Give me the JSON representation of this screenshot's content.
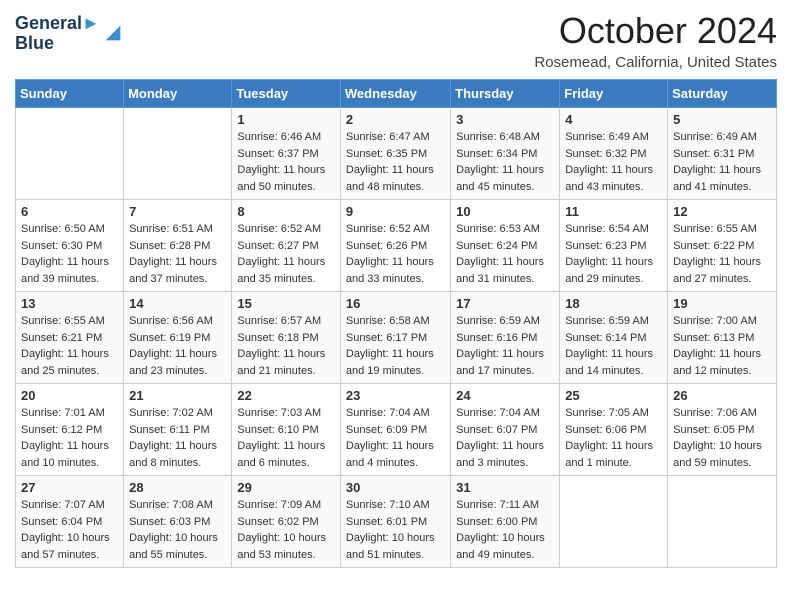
{
  "logo": {
    "line1": "General",
    "line2": "Blue"
  },
  "title": "October 2024",
  "location": "Rosemead, California, United States",
  "days_header": [
    "Sunday",
    "Monday",
    "Tuesday",
    "Wednesday",
    "Thursday",
    "Friday",
    "Saturday"
  ],
  "weeks": [
    [
      {
        "day": "",
        "sunrise": "",
        "sunset": "",
        "daylight": ""
      },
      {
        "day": "",
        "sunrise": "",
        "sunset": "",
        "daylight": ""
      },
      {
        "day": "1",
        "sunrise": "Sunrise: 6:46 AM",
        "sunset": "Sunset: 6:37 PM",
        "daylight": "Daylight: 11 hours and 50 minutes."
      },
      {
        "day": "2",
        "sunrise": "Sunrise: 6:47 AM",
        "sunset": "Sunset: 6:35 PM",
        "daylight": "Daylight: 11 hours and 48 minutes."
      },
      {
        "day": "3",
        "sunrise": "Sunrise: 6:48 AM",
        "sunset": "Sunset: 6:34 PM",
        "daylight": "Daylight: 11 hours and 45 minutes."
      },
      {
        "day": "4",
        "sunrise": "Sunrise: 6:49 AM",
        "sunset": "Sunset: 6:32 PM",
        "daylight": "Daylight: 11 hours and 43 minutes."
      },
      {
        "day": "5",
        "sunrise": "Sunrise: 6:49 AM",
        "sunset": "Sunset: 6:31 PM",
        "daylight": "Daylight: 11 hours and 41 minutes."
      }
    ],
    [
      {
        "day": "6",
        "sunrise": "Sunrise: 6:50 AM",
        "sunset": "Sunset: 6:30 PM",
        "daylight": "Daylight: 11 hours and 39 minutes."
      },
      {
        "day": "7",
        "sunrise": "Sunrise: 6:51 AM",
        "sunset": "Sunset: 6:28 PM",
        "daylight": "Daylight: 11 hours and 37 minutes."
      },
      {
        "day": "8",
        "sunrise": "Sunrise: 6:52 AM",
        "sunset": "Sunset: 6:27 PM",
        "daylight": "Daylight: 11 hours and 35 minutes."
      },
      {
        "day": "9",
        "sunrise": "Sunrise: 6:52 AM",
        "sunset": "Sunset: 6:26 PM",
        "daylight": "Daylight: 11 hours and 33 minutes."
      },
      {
        "day": "10",
        "sunrise": "Sunrise: 6:53 AM",
        "sunset": "Sunset: 6:24 PM",
        "daylight": "Daylight: 11 hours and 31 minutes."
      },
      {
        "day": "11",
        "sunrise": "Sunrise: 6:54 AM",
        "sunset": "Sunset: 6:23 PM",
        "daylight": "Daylight: 11 hours and 29 minutes."
      },
      {
        "day": "12",
        "sunrise": "Sunrise: 6:55 AM",
        "sunset": "Sunset: 6:22 PM",
        "daylight": "Daylight: 11 hours and 27 minutes."
      }
    ],
    [
      {
        "day": "13",
        "sunrise": "Sunrise: 6:55 AM",
        "sunset": "Sunset: 6:21 PM",
        "daylight": "Daylight: 11 hours and 25 minutes."
      },
      {
        "day": "14",
        "sunrise": "Sunrise: 6:56 AM",
        "sunset": "Sunset: 6:19 PM",
        "daylight": "Daylight: 11 hours and 23 minutes."
      },
      {
        "day": "15",
        "sunrise": "Sunrise: 6:57 AM",
        "sunset": "Sunset: 6:18 PM",
        "daylight": "Daylight: 11 hours and 21 minutes."
      },
      {
        "day": "16",
        "sunrise": "Sunrise: 6:58 AM",
        "sunset": "Sunset: 6:17 PM",
        "daylight": "Daylight: 11 hours and 19 minutes."
      },
      {
        "day": "17",
        "sunrise": "Sunrise: 6:59 AM",
        "sunset": "Sunset: 6:16 PM",
        "daylight": "Daylight: 11 hours and 17 minutes."
      },
      {
        "day": "18",
        "sunrise": "Sunrise: 6:59 AM",
        "sunset": "Sunset: 6:14 PM",
        "daylight": "Daylight: 11 hours and 14 minutes."
      },
      {
        "day": "19",
        "sunrise": "Sunrise: 7:00 AM",
        "sunset": "Sunset: 6:13 PM",
        "daylight": "Daylight: 11 hours and 12 minutes."
      }
    ],
    [
      {
        "day": "20",
        "sunrise": "Sunrise: 7:01 AM",
        "sunset": "Sunset: 6:12 PM",
        "daylight": "Daylight: 11 hours and 10 minutes."
      },
      {
        "day": "21",
        "sunrise": "Sunrise: 7:02 AM",
        "sunset": "Sunset: 6:11 PM",
        "daylight": "Daylight: 11 hours and 8 minutes."
      },
      {
        "day": "22",
        "sunrise": "Sunrise: 7:03 AM",
        "sunset": "Sunset: 6:10 PM",
        "daylight": "Daylight: 11 hours and 6 minutes."
      },
      {
        "day": "23",
        "sunrise": "Sunrise: 7:04 AM",
        "sunset": "Sunset: 6:09 PM",
        "daylight": "Daylight: 11 hours and 4 minutes."
      },
      {
        "day": "24",
        "sunrise": "Sunrise: 7:04 AM",
        "sunset": "Sunset: 6:07 PM",
        "daylight": "Daylight: 11 hours and 3 minutes."
      },
      {
        "day": "25",
        "sunrise": "Sunrise: 7:05 AM",
        "sunset": "Sunset: 6:06 PM",
        "daylight": "Daylight: 11 hours and 1 minute."
      },
      {
        "day": "26",
        "sunrise": "Sunrise: 7:06 AM",
        "sunset": "Sunset: 6:05 PM",
        "daylight": "Daylight: 10 hours and 59 minutes."
      }
    ],
    [
      {
        "day": "27",
        "sunrise": "Sunrise: 7:07 AM",
        "sunset": "Sunset: 6:04 PM",
        "daylight": "Daylight: 10 hours and 57 minutes."
      },
      {
        "day": "28",
        "sunrise": "Sunrise: 7:08 AM",
        "sunset": "Sunset: 6:03 PM",
        "daylight": "Daylight: 10 hours and 55 minutes."
      },
      {
        "day": "29",
        "sunrise": "Sunrise: 7:09 AM",
        "sunset": "Sunset: 6:02 PM",
        "daylight": "Daylight: 10 hours and 53 minutes."
      },
      {
        "day": "30",
        "sunrise": "Sunrise: 7:10 AM",
        "sunset": "Sunset: 6:01 PM",
        "daylight": "Daylight: 10 hours and 51 minutes."
      },
      {
        "day": "31",
        "sunrise": "Sunrise: 7:11 AM",
        "sunset": "Sunset: 6:00 PM",
        "daylight": "Daylight: 10 hours and 49 minutes."
      },
      {
        "day": "",
        "sunrise": "",
        "sunset": "",
        "daylight": ""
      },
      {
        "day": "",
        "sunrise": "",
        "sunset": "",
        "daylight": ""
      }
    ]
  ]
}
